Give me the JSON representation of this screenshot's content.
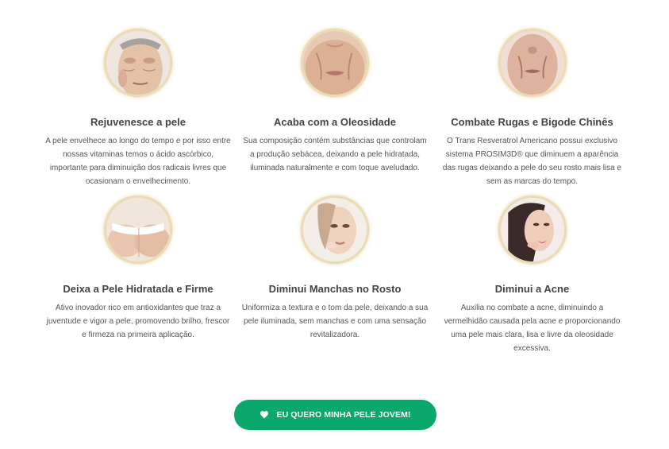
{
  "benefits": [
    {
      "title": "Rejuvenesce a pele",
      "description": "A pele envelhece ao longo do tempo e por isso entre nossas vitaminas temos o ácido ascórbico, importante para diminuição dos radicais livres que ocasionam o envelhecimento.",
      "image": "aging-face-photo"
    },
    {
      "title": "Acaba com a Oleosidade",
      "description": "Sua composição contém substâncias que controlam a produção sebácea, deixando a pele hidratada, iluminada naturalmente e com toque aveludado.",
      "image": "mouth-wrinkles-photo"
    },
    {
      "title": "Combate Rugas e Bigode Chinês",
      "description": "O Trans Resveratrol Americano possui exclusivo sistema PROSIM3D® que diminuem a aparência das rugas deixando a pele do seu rosto mais lisa e sem as marcas do tempo.",
      "image": "smile-lines-photo"
    },
    {
      "title": "Deixa a Pele Hidratada e Firme",
      "description": "Ativo inovador rico em antioxidantes que traz a juventude e vigor a pele, promovendo brilho, frescor e firmeza na primeira aplicação.",
      "image": "firm-skin-photo"
    },
    {
      "title": "Diminui Manchas no Rosto",
      "description": "Uniformiza a textura e o tom da pele, deixando a sua pele iluminada, sem manchas e com uma sensação revitalizadora.",
      "image": "clear-face-photo"
    },
    {
      "title": "Diminui a Acne",
      "description": "Auxilia no combate a acne, diminuindo a vermelhidão causada pela acne e proporcionando uma pele mais clara, lisa e livre da oleosidade excessiva.",
      "image": "acne-free-face-photo"
    }
  ],
  "cta": {
    "label": "EU QUERO MINHA PELE JOVEM!",
    "icon": "heart-icon"
  },
  "colors": {
    "cta_background": "#0aa86b",
    "title_text": "#444444",
    "body_text": "#555555",
    "ring_gold": "#e9dcb6"
  }
}
